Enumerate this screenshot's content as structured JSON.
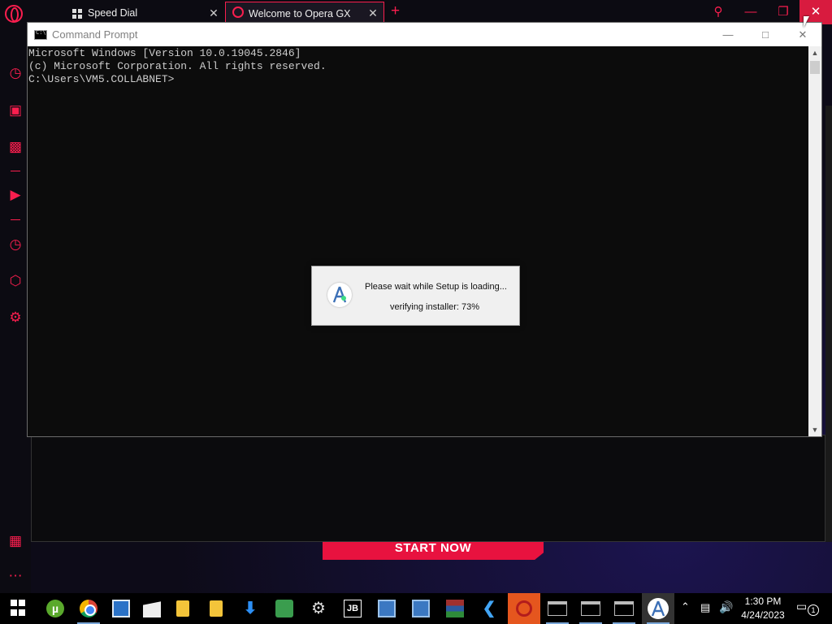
{
  "browser": {
    "tabs": [
      {
        "title": "Speed Dial",
        "icon": "grid-icon"
      },
      {
        "title": "Welcome to Opera GX",
        "icon": "opera-icon"
      }
    ],
    "new_tab": "+",
    "sidebar_icons": [
      "speedometer-icon",
      "shopping-icon",
      "gx-control-icon",
      "player-icon",
      "history-icon",
      "cube-icon",
      "settings-icon",
      "gallery-icon",
      "more-icon"
    ],
    "cta_button": "START NOW",
    "accent_color": "#fa1e4e"
  },
  "cmd": {
    "title": "Command Prompt",
    "lines": [
      "Microsoft Windows [Version 10.0.19045.2846]",
      "(c) Microsoft Corporation. All rights reserved.",
      "",
      "C:\\Users\\VM5.COLLABNET>"
    ]
  },
  "setup_dialog": {
    "message": "Please wait while Setup is loading...",
    "status": "verifying installer: 73%",
    "progress_percent": 73
  },
  "taskbar": {
    "apps": [
      "start",
      "utorrent",
      "chrome",
      "app-box",
      "clapper",
      "file-explorer",
      "notes",
      "downloader",
      "spreadsheet",
      "settings",
      "jetbrains-toolbox",
      "this-pc",
      "this-pc-2",
      "winrar",
      "flutter",
      "opera-gx",
      "terminal-1",
      "terminal-2",
      "terminal-3",
      "android-studio"
    ],
    "time": "1:30 PM",
    "date": "4/24/2023",
    "notification_count": "1"
  }
}
